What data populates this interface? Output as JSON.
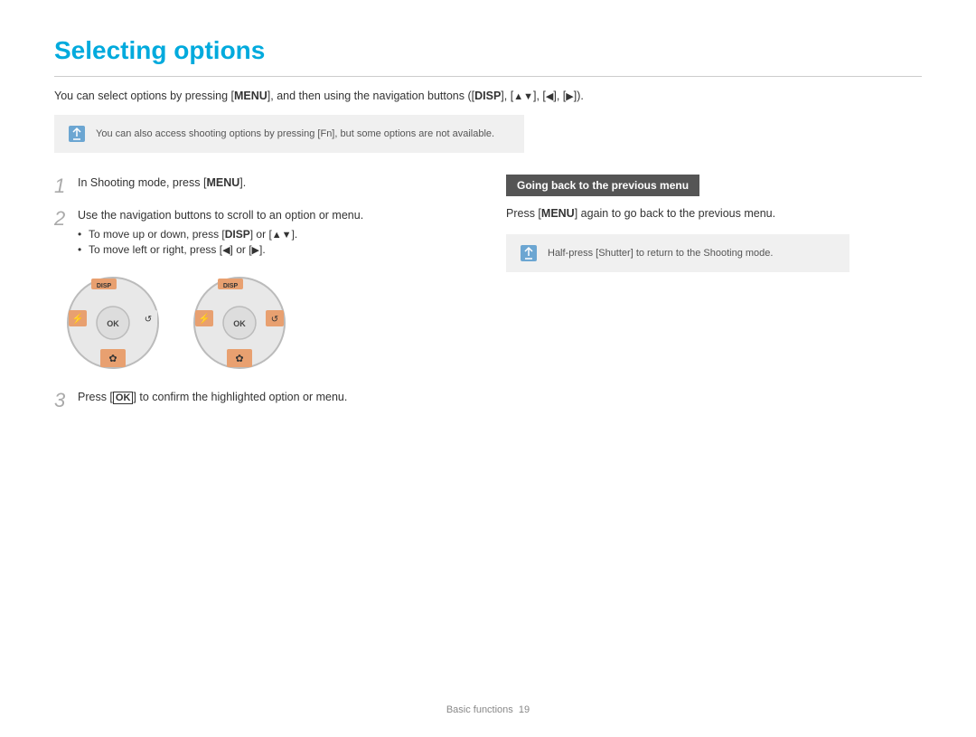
{
  "page": {
    "title": "Selecting options",
    "intro": {
      "text_before": "You can select options by pressing [",
      "menu_key": "MENU",
      "text_middle": "], and then using the navigation buttons ([",
      "disp_key": "DISP",
      "text_end": "], [▲▼], [◄], [►])."
    },
    "note1": {
      "text": "You can also access shooting options by pressing [Fn], but some options are not available."
    },
    "steps": [
      {
        "num": "1",
        "text_before": "In Shooting mode, press [",
        "key": "MENU",
        "text_after": "]."
      },
      {
        "num": "2",
        "text": "Use the navigation buttons to scroll to an option or menu.",
        "bullets": [
          "To move up or down, press [DISP] or [▲▼].",
          "To move left or right, press [◄] or [►]."
        ]
      },
      {
        "num": "3",
        "text_before": "Press [",
        "key": "OK",
        "text_after": "] to confirm the highlighted option or menu."
      }
    ],
    "right_section": {
      "header": "Going back to the previous menu",
      "text_before": "Press [",
      "key": "MENU",
      "text_after": "] again to go back to the previous menu.",
      "note": "Half-press [Shutter] to return to the Shooting mode."
    },
    "footer": {
      "text": "Basic functions",
      "page_num": "19"
    }
  }
}
